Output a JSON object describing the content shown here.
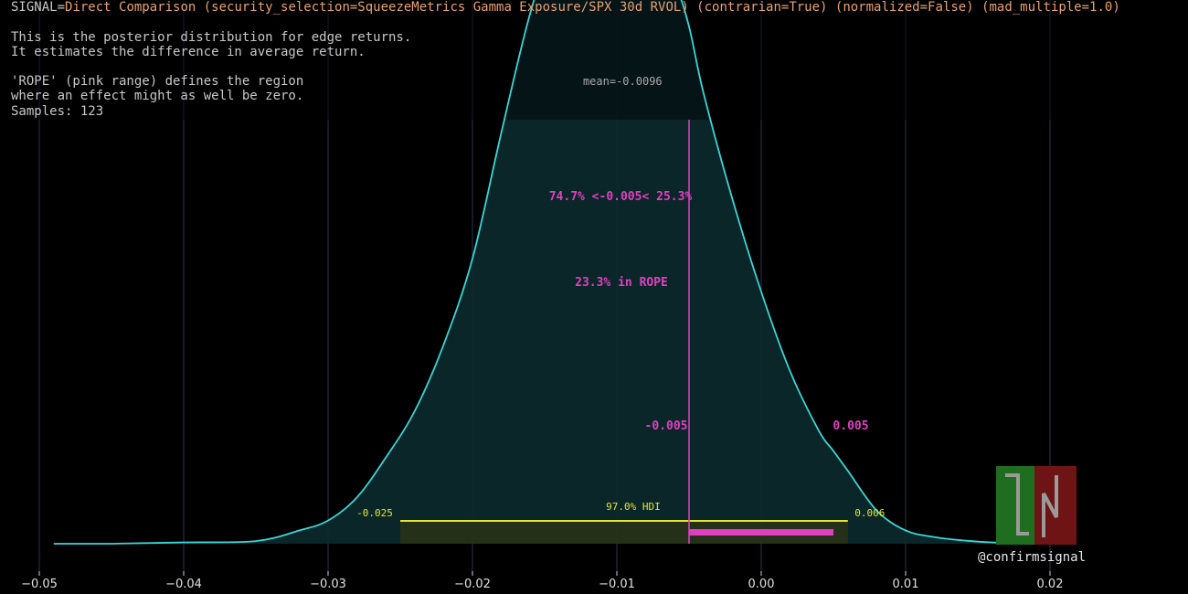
{
  "header": {
    "signal_key": "SIGNAL=",
    "signal_value": "Direct Comparison (security_selection=SqueezeMetrics Gamma Exposure/SPX 30d RVOL) (contrarian=True) (normalized=False) (mad_multiple=1.0)",
    "desc_line1": "This is the posterior distribution for edge returns.",
    "desc_line2": "It estimates the difference in average return.",
    "rope_line1": "'ROPE' (pink range) defines the region",
    "rope_line2": "where an effect might as well be zero.",
    "samples": "Samples: 123"
  },
  "watermark": "@confirmsignal",
  "colors": {
    "background": "#000000",
    "curve": "#3ad6d6",
    "fill": "#0b2a2c",
    "rope": "#e040c0",
    "hdi": "#e6e62a",
    "hdi_fill": "#2a3316",
    "grid": "#2e3450",
    "text": "#c8c8c8",
    "signal": "#e8a070",
    "logo_green": "#1f6e1f",
    "logo_red": "#6e1414"
  },
  "chart_data": {
    "type": "area",
    "title": "",
    "xlabel": "",
    "ylabel": "",
    "xlim": [
      -0.05,
      0.021
    ],
    "x_ticks": [
      -0.05,
      -0.04,
      -0.03,
      -0.02,
      -0.01,
      0.0,
      0.01,
      0.02
    ],
    "x_tick_labels": [
      "−0.05",
      "−0.04",
      "−0.03",
      "−0.02",
      "−0.01",
      "0.00",
      "0.01",
      "0.02"
    ],
    "grid": "vertical",
    "density": {
      "x": [
        -0.049,
        -0.045,
        -0.04,
        -0.035,
        -0.032,
        -0.03,
        -0.028,
        -0.026,
        -0.024,
        -0.022,
        -0.02,
        -0.018,
        -0.016,
        -0.014,
        -0.012,
        -0.01,
        -0.008,
        -0.006,
        -0.005,
        -0.004,
        -0.002,
        0.0,
        0.002,
        0.004,
        0.005,
        0.006,
        0.008,
        0.01,
        0.012,
        0.014,
        0.016,
        0.02
      ],
      "y": [
        0.0,
        0.0,
        0.002,
        0.004,
        0.02,
        0.035,
        0.07,
        0.13,
        0.2,
        0.3,
        0.43,
        0.62,
        0.8,
        0.93,
        0.99,
        1.0,
        0.97,
        0.85,
        0.78,
        0.68,
        0.52,
        0.38,
        0.26,
        0.17,
        0.14,
        0.11,
        0.05,
        0.02,
        0.01,
        0.005,
        0.002,
        0.0
      ],
      "ymax_visible": 0.82
    },
    "mean_label": "mean=-0.0096",
    "mean": -0.0096,
    "rope": {
      "low": -0.005,
      "high": 0.005,
      "low_label": "-0.005",
      "high_label": "0.005"
    },
    "split_label": "74.7% <-0.005< 25.3%",
    "rope_label": "23.3% in ROPE",
    "hdi": {
      "low": -0.025,
      "high": 0.006,
      "label": "97.0% HDI",
      "low_label": "-0.025",
      "high_label": "0.006"
    }
  }
}
